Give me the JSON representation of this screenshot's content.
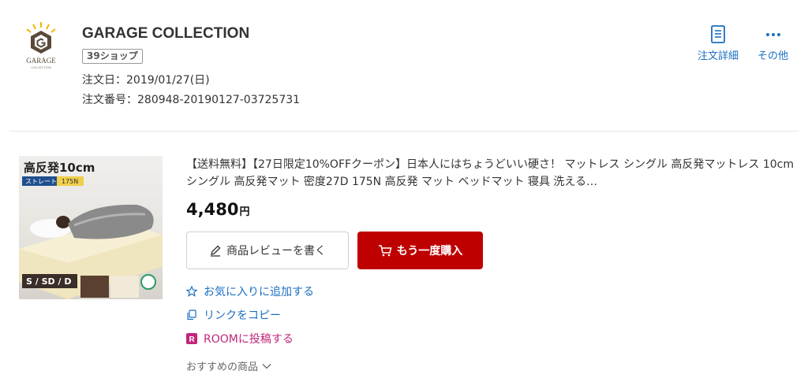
{
  "shop": {
    "logo_text": "GARAGE",
    "logo_subtext": "COLLECTION",
    "name": "GARAGE COLLECTION",
    "badge": "39ショップ",
    "order_date": "注文日：2019/01/27(日)",
    "order_number": "注文番号：280948-20190127-03725731"
  },
  "actions": {
    "order_detail": "注文詳細",
    "other": "その他"
  },
  "product": {
    "image": {
      "headline": "高反発10cm",
      "tag_left": "ストレート",
      "tag_right": "175N",
      "sizes": "S / SD / D"
    },
    "title": "【送料無料】【27日限定10%OFFクーポン】日本人にはちょうどいい硬さ！ マットレス シングル 高反発マットレス 10cm シングル 高反発マット 密度27D 175N 高反発 マット ベッドマット 寝具 洗える…",
    "price": "4,480",
    "price_unit": "円",
    "review_button": "商品レビューを書く",
    "rebuy_button": "もう一度購入",
    "favorite_link": "お気に入りに追加する",
    "copy_link": "リンクをコピー",
    "room_link": "ROOMに投稿する",
    "recommend_link": "おすすめの商品"
  },
  "colors": {
    "link_blue": "#1b6fc1",
    "rakuten_red": "#bf0000",
    "room_pink": "#c0267a"
  },
  "icons": [
    "garage-logo",
    "document-list-icon",
    "more-dots-icon",
    "pencil-icon",
    "cart-icon",
    "star-icon",
    "copy-icon",
    "room-icon",
    "chevron-down-icon"
  ]
}
